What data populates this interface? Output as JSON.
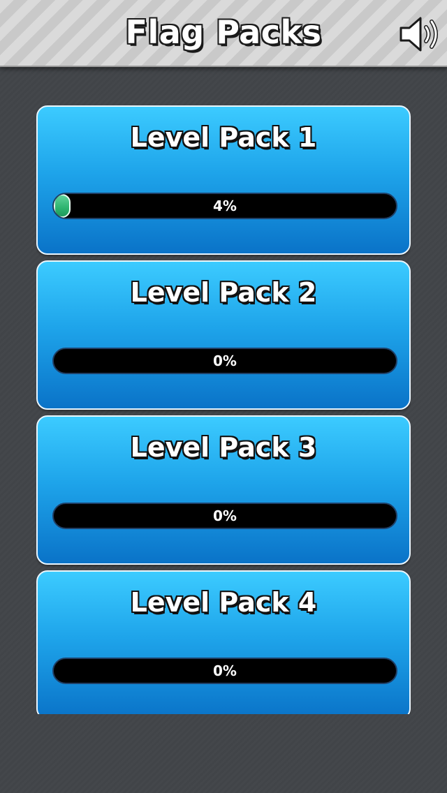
{
  "header": {
    "title": "Flag Packs",
    "sound_icon": "speaker-volume-icon"
  },
  "colors": {
    "card_top": "#3ccbff",
    "card_bottom": "#0a73c8",
    "progress_fill": "#2db36f",
    "progress_track": "#000000",
    "background": "#424549"
  },
  "packs": [
    {
      "title": "Level Pack 1",
      "progress_label": "4%",
      "progress": 4
    },
    {
      "title": "Level Pack 2",
      "progress_label": "0%",
      "progress": 0
    },
    {
      "title": "Level Pack 3",
      "progress_label": "0%",
      "progress": 0
    },
    {
      "title": "Level Pack 4",
      "progress_label": "0%",
      "progress": 0
    }
  ]
}
